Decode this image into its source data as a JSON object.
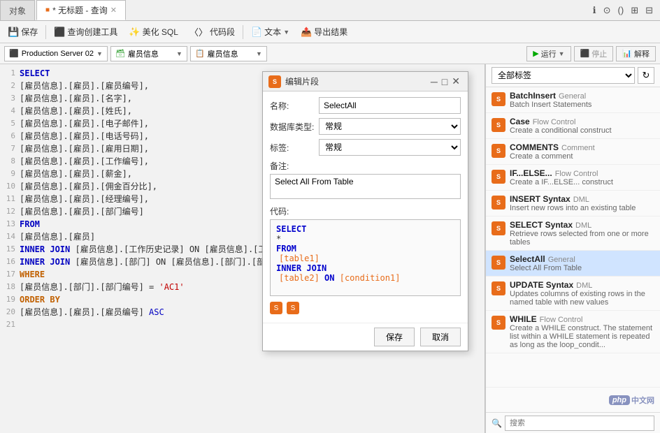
{
  "app": {
    "tab_inactive": "对象",
    "tab_active": "* 无标题 - 查询",
    "top_icons": [
      "ℹ",
      "⊙",
      "()",
      "⊞",
      "⊟"
    ]
  },
  "toolbar": {
    "save": "保存",
    "query_builder": "查询创建工具",
    "beautify": "美化 SQL",
    "code_snippet": "代码段",
    "text": "文本",
    "export": "导出结果"
  },
  "db_toolbar": {
    "server": "Production Server 02",
    "db1": "雇员信息",
    "db2": "雇员信息",
    "run": "运行",
    "stop": "停止",
    "explain": "解释"
  },
  "sql_lines": [
    {
      "num": "1",
      "content": "SELECT",
      "type": "keyword_blue"
    },
    {
      "num": "2",
      "content": "[雇员信息].[雇员].[雇员编号],",
      "type": "normal"
    },
    {
      "num": "3",
      "content": "[雇员信息].[雇员].[名字],",
      "type": "normal"
    },
    {
      "num": "4",
      "content": "[雇员信息].[雇员].[姓氏],",
      "type": "normal"
    },
    {
      "num": "5",
      "content": "[雇员信息].[雇员].[电子邮件],",
      "type": "normal"
    },
    {
      "num": "6",
      "content": "[雇员信息].[雇员].[电话号码],",
      "type": "normal"
    },
    {
      "num": "7",
      "content": "[雇员信息].[雇员].[雇用日期],",
      "type": "normal"
    },
    {
      "num": "8",
      "content": "[雇员信息].[雇员].[工作编号],",
      "type": "normal"
    },
    {
      "num": "9",
      "content": "[雇员信息].[雇员].[薪金],",
      "type": "normal"
    },
    {
      "num": "10",
      "content": "[雇员信息].[雇员].[佣金百分比],",
      "type": "normal"
    },
    {
      "num": "11",
      "content": "[雇员信息].[雇员].[经理编号],",
      "type": "normal"
    },
    {
      "num": "12",
      "content": "[雇员信息].[雇员].[部门编号]",
      "type": "normal"
    },
    {
      "num": "13",
      "content": "FROM",
      "type": "keyword_blue"
    },
    {
      "num": "14",
      "content": "[雇员信息].[雇员]",
      "type": "normal"
    },
    {
      "num": "15",
      "content": "INNER JOIN [雇员信息].[工作历史记录] ON [雇员信息].[工作历史记录].[雇员...",
      "type": "inner_join"
    },
    {
      "num": "16",
      "content": "INNER JOIN [雇员信息].[部门] ON [雇员信息].[部门].[部门编号] = ...",
      "type": "inner_join"
    },
    {
      "num": "17",
      "content": "WHERE",
      "type": "keyword_brown"
    },
    {
      "num": "18",
      "content": "[雇员信息].[部门].[部门编号] = 'AC1'",
      "type": "where_line"
    },
    {
      "num": "19",
      "content": "ORDER BY",
      "type": "keyword_brown"
    },
    {
      "num": "20",
      "content": "[雇员信息].[雇员].[雇员编号] ASC",
      "type": "order_line"
    },
    {
      "num": "21",
      "content": "",
      "type": "normal"
    }
  ],
  "right_panel": {
    "tags_label": "全部标签",
    "snippets": [
      {
        "id": "batchinsert",
        "title": "BatchInsert",
        "tag": "General",
        "desc": "Batch Insert Statements"
      },
      {
        "id": "case",
        "title": "Case",
        "tag": "Flow Control",
        "desc": "Create a conditional construct"
      },
      {
        "id": "comments",
        "title": "COMMENTS",
        "tag": "Comment",
        "desc": "Create a comment"
      },
      {
        "id": "ifelse",
        "title": "IF...ELSE...",
        "tag": "Flow Control",
        "desc": "Create a IF...ELSE... construct"
      },
      {
        "id": "insert",
        "title": "INSERT Syntax",
        "tag": "DML",
        "desc": "Insert new rows into an existing table"
      },
      {
        "id": "selectsyntax",
        "title": "SELECT Syntax",
        "tag": "DML",
        "desc": "Retrieve rows selected from one or more tables"
      },
      {
        "id": "selectall",
        "title": "SelectAll",
        "tag": "General",
        "desc": "Select All From Table"
      },
      {
        "id": "update",
        "title": "UPDATE Syntax",
        "tag": "DML",
        "desc": "Updates columns of existing rows in the named table with new values"
      },
      {
        "id": "while",
        "title": "WHILE",
        "tag": "Flow Control",
        "desc": "Create a WHILE construct. The statement list within a WHILE statement is repeated as long as the loop_condit..."
      }
    ],
    "search_placeholder": "搜索"
  },
  "modal": {
    "title": "编辑片段",
    "name_label": "名称:",
    "name_value": "SelectAll",
    "db_type_label": "数据库类型:",
    "db_type_value": "常规",
    "tag_label": "标签:",
    "tag_value": "常规",
    "note_label": "备注:",
    "note_value": "Select All From Table",
    "code_label": "代码:",
    "code_lines": [
      {
        "text": "SELECT",
        "type": "kw_blue"
      },
      {
        "text": "*",
        "type": "normal"
      },
      {
        "text": "FROM",
        "type": "kw_blue"
      },
      {
        "text": "  [table1]",
        "type": "bracket"
      },
      {
        "text": "INNER JOIN",
        "type": "kw_blue"
      },
      {
        "text": "  [table2] ON [condition1]",
        "type": "bracket"
      }
    ],
    "save_btn": "保存",
    "cancel_btn": "取消"
  }
}
